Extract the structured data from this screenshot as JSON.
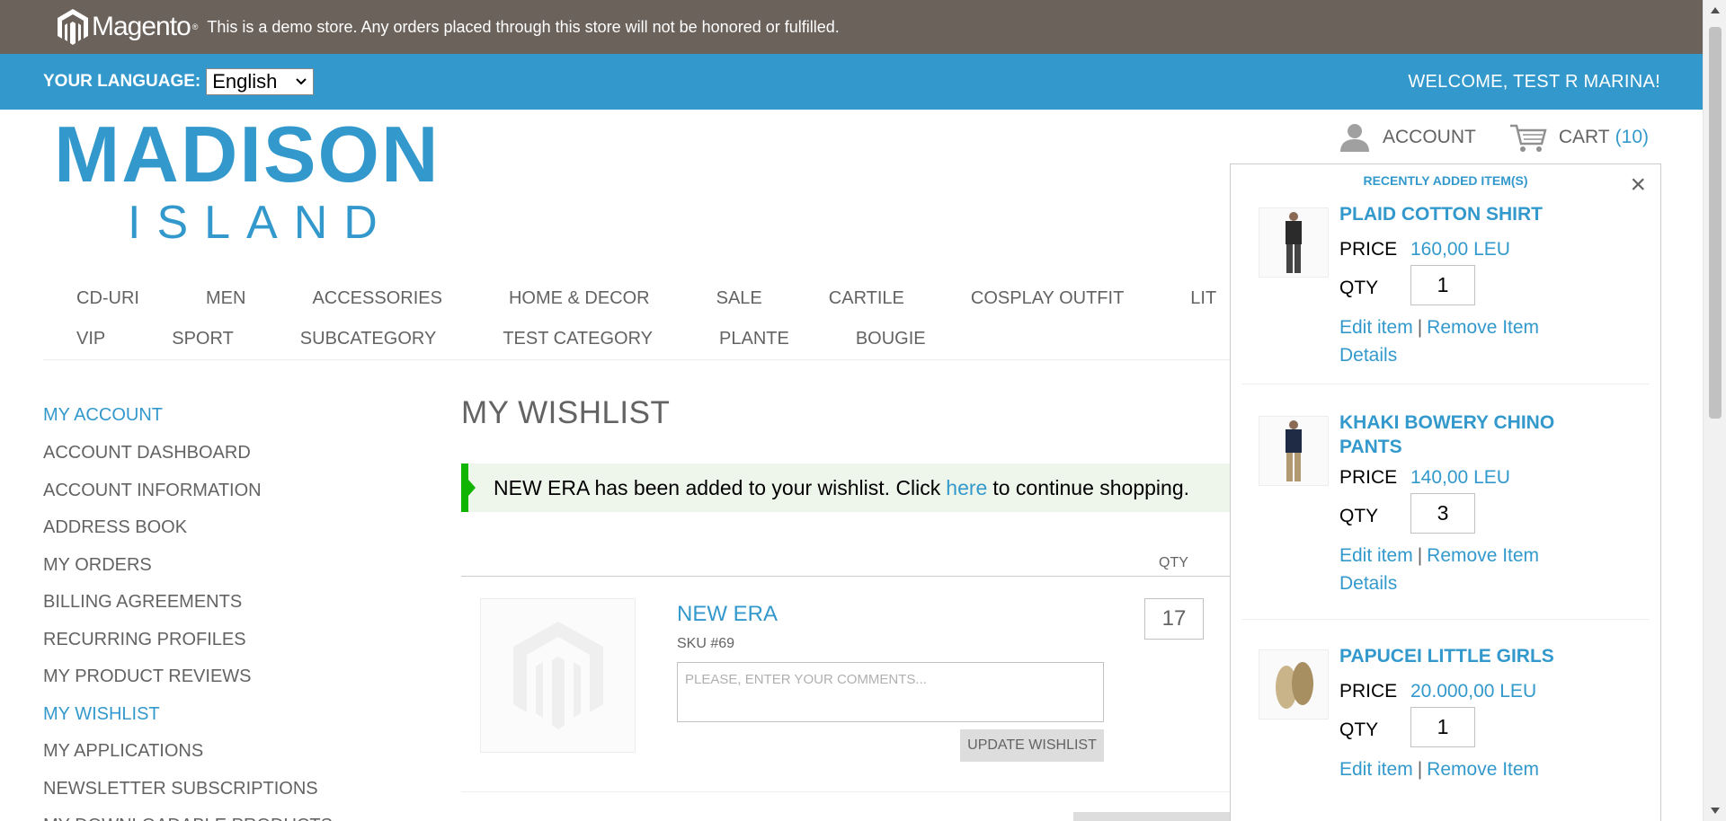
{
  "demo_notice": {
    "logo_text": "Magento",
    "logo_tm": "®",
    "text": "This is a demo store. Any orders placed through this store will not be honored or fulfilled."
  },
  "language_bar": {
    "label": "YOUR LANGUAGE:",
    "selected_language": "English",
    "welcome": "WELCOME, TEST R MARINA!"
  },
  "logo": {
    "top": "MADISON",
    "bottom": "ISLAND"
  },
  "header": {
    "account_label": "ACCOUNT",
    "cart_label": "CART",
    "cart_count": "(10)"
  },
  "nav": {
    "row1": [
      "CD-URI",
      "MEN",
      "ACCESSORIES",
      "HOME & DECOR",
      "SALE",
      "CARTILE",
      "COSPLAY OUTFIT",
      "LIT"
    ],
    "row2": [
      "VIP",
      "SPORT",
      "SUBCATEGORY",
      "TEST CATEGORY",
      "PLANTE",
      "BOUGIE"
    ]
  },
  "sidebar": {
    "title": "MY ACCOUNT",
    "items": [
      "ACCOUNT DASHBOARD",
      "ACCOUNT INFORMATION",
      "ADDRESS BOOK",
      "MY ORDERS",
      "BILLING AGREEMENTS",
      "RECURRING PROFILES",
      "MY PRODUCT REVIEWS",
      "MY WISHLIST",
      "MY APPLICATIONS",
      "NEWSLETTER SUBSCRIPTIONS",
      "MY DOWNLOADABLE PRODUCTS"
    ],
    "active_item": "MY WISHLIST"
  },
  "main": {
    "title": "MY WISHLIST",
    "success_before": "NEW ERA has been added to your wishlist. Click",
    "success_link": "here",
    "success_after": "to continue shopping.",
    "qty_header": "QTY",
    "item": {
      "name": "NEW ERA",
      "sku": "SKU #69",
      "comment_placeholder": "PLEASE, ENTER YOUR COMMENTS...",
      "qty": "17",
      "update_button": "UPDATE WISHLIST"
    }
  },
  "minicart": {
    "title": "RECENTLY ADDED ITEM(S)",
    "close": "×",
    "price_label": "PRICE",
    "qty_label": "QTY",
    "edit_label": "Edit item",
    "separator": "|",
    "remove_label": "Remove Item",
    "details_label": "Details",
    "items": [
      {
        "name": "PLAID COTTON SHIRT",
        "price": "160,00 LEU",
        "qty": "1"
      },
      {
        "name": "KHAKI BOWERY CHINO PANTS",
        "price": "140,00 LEU",
        "qty": "3"
      },
      {
        "name": "PAPUCEI LITTLE GIRLS",
        "price": "20.000,00 LEU",
        "qty": "1"
      }
    ]
  },
  "colors": {
    "brand_blue": "#3399cc",
    "demo_bar": "#6b625b",
    "success_green": "#11b400",
    "text_gray": "#636363"
  },
  "icons": [
    "magento-logo-icon",
    "account-icon",
    "cart-icon",
    "close-icon",
    "chevron-down-icon",
    "placeholder-image-icon"
  ]
}
